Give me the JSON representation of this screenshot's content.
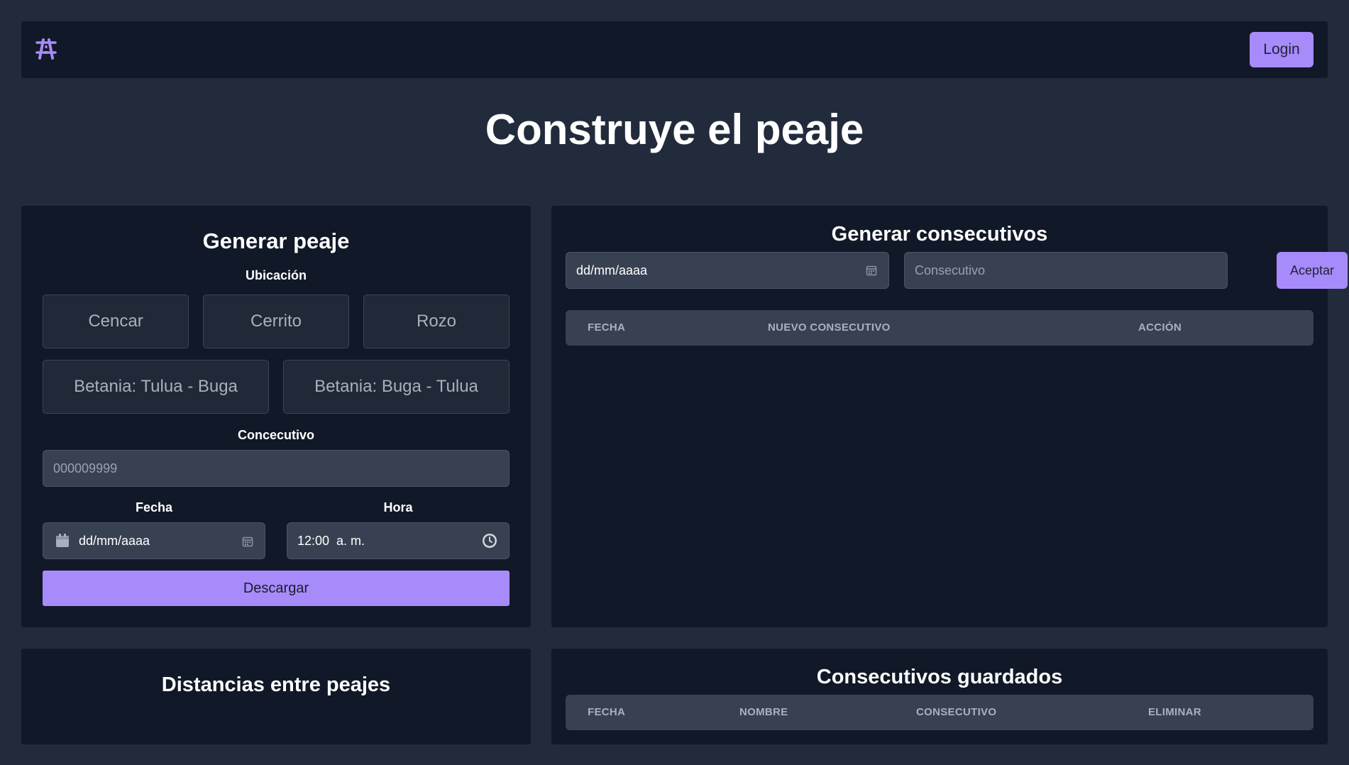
{
  "nav": {
    "login_label": "Login"
  },
  "page": {
    "title": "Construye el peaje"
  },
  "generar_peaje": {
    "title": "Generar peaje",
    "ubicacion_label": "Ubicación",
    "locations": [
      "Cencar",
      "Cerrito",
      "Rozo",
      "Betania: Tulua - Buga",
      "Betania: Buga - Tulua"
    ],
    "consecutivo_label": "Concecutivo",
    "consecutivo_placeholder": "000009999",
    "fecha_label": "Fecha",
    "fecha_value": "dd/mm/aaaa",
    "hora_label": "Hora",
    "hora_value": "12:00  a. m.",
    "descargar_label": "Descargar"
  },
  "generar_consecutivos": {
    "title": "Generar consecutivos",
    "fecha_value": "dd/mm/aaaa",
    "consecutivo_placeholder": "Consecutivo",
    "aceptar_label": "Aceptar",
    "columns": [
      "FECHA",
      "NUEVO CONSECUTIVO",
      "ACCIÓN"
    ]
  },
  "distancias": {
    "title": "Distancias entre peajes"
  },
  "consecutivos_guardados": {
    "title": "Consecutivos guardados",
    "columns": [
      "FECHA",
      "NOMBRE",
      "CONSECUTIVO",
      "ELIMINAR"
    ]
  },
  "colors": {
    "accent": "#a78bfa",
    "background": "#212b3b",
    "card": "#111827",
    "input": "#374151"
  },
  "icons": [
    "road-logo-icon",
    "calendar-icon",
    "calendar-picker-icon",
    "clock-icon"
  ]
}
